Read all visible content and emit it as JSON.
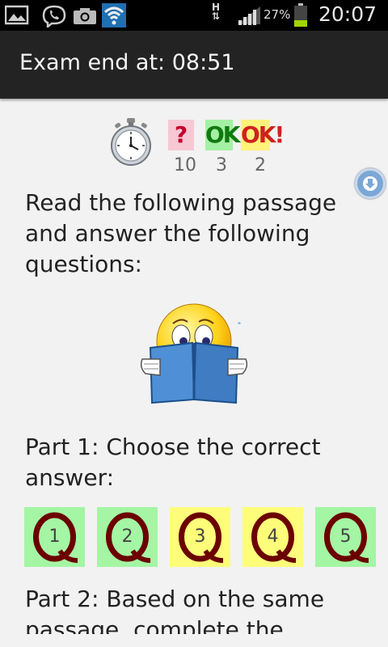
{
  "status_bar": {
    "time": "20:07",
    "battery_percent": "27%",
    "network_type": "H",
    "icons": [
      "gallery-icon",
      "viber-icon",
      "camera-icon",
      "wifi-icon",
      "data-transfer-icon",
      "signal-icon",
      "battery-icon"
    ]
  },
  "action_bar": {
    "title": "Exam end at: 08:51"
  },
  "stats": {
    "unanswered_symbol": "?",
    "correct_symbol": "OK",
    "answered_symbol": "OK!",
    "unanswered_count": "10",
    "correct_count": "3",
    "answered_count": "2",
    "colors": {
      "unanswered": "#f7c7d4",
      "correct": "#a4f0a4",
      "answered": "#fff27a"
    }
  },
  "content": {
    "instructions": "Read the following passage and answer the following questions:",
    "part1_heading": "Part 1: Choose the correct answer:",
    "part2_heading": "Part 2: Based on the same passage, complete the",
    "questions": [
      {
        "number": "1",
        "state": "green"
      },
      {
        "number": "2",
        "state": "green"
      },
      {
        "number": "3",
        "state": "yellow"
      },
      {
        "number": "4",
        "state": "yellow"
      },
      {
        "number": "5",
        "state": "green"
      }
    ]
  }
}
